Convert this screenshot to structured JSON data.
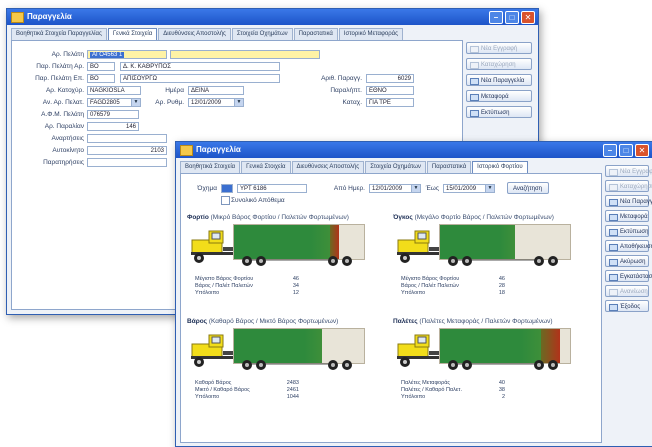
{
  "colors": {
    "accent": "#2f63cf",
    "fill_green": "#2e8a3c",
    "fill_red": "#b2321a",
    "trailer": "#e8e4d8",
    "cab_yellow": "#f2dd1a"
  },
  "back_window": {
    "title": "Παραγγελία",
    "tabs": [
      "Βοηθητικά Στοιχεία Παραγγελίας",
      "Γενικά Στοιχεία",
      "Διευθύνσεις Αποστολής",
      "Στοιχεία Οχημάτων",
      "Παραστατικά",
      "Ιστορικό Μεταφοράς"
    ],
    "active_tab": 1,
    "fields": [
      {
        "label": "Αρ. Πελάτη",
        "value": "ΑΓΟ4563 1"
      },
      {
        "label": "Παρ. Πελάτη Αρ.",
        "value": "BO"
      },
      {
        "label": "Παρ. Πελάτη Επ.",
        "value": "BO"
      },
      {
        "label": "Αρ. Κατοχύρ.",
        "value": "NAGKIOSLA"
      },
      {
        "label": "Αν. Αρ. Πελατ.",
        "value": "FAGD2805"
      },
      {
        "label": "Α.Φ.Μ. Πελάτη",
        "value": "076579"
      },
      {
        "label": "Αρ. Παραλίαν",
        "value": "146"
      },
      {
        "label": "Αναρτήσεις",
        "value": ""
      },
      {
        "label": "Αυτοκίνητο",
        "value": "2103"
      },
      {
        "label": "Παρατηρήσεις",
        "value": ""
      }
    ],
    "field_extra": {
      "name1": "Δ. Κ. ΚΑΘΡΥΠΟΣ",
      "name2": "ΑΠΙΣΟΥΡΓΩ"
    },
    "mid_fields": [
      {
        "label": "Ημέρα",
        "value": "ΔΕΙΝΑ"
      },
      {
        "label": "Αρ. Ρυθμ.",
        "value": "12/01/2009"
      }
    ],
    "right_fields": [
      {
        "label": "Αριθ. Παραγγ.",
        "value": "6029"
      },
      {
        "label": "Παραλήπτ.",
        "value": "ΕΘΝΟ"
      },
      {
        "label": "Καταχ.",
        "value": "ΓΙΑ ΤΡΕ"
      }
    ],
    "side_buttons": [
      {
        "label": "Νέα Εγγραφή",
        "enabled": false
      },
      {
        "label": "Καταχώρηση",
        "enabled": false
      },
      {
        "label": "Νέα Παραγγελία",
        "enabled": true
      },
      {
        "label": "Μεταφορά",
        "enabled": true
      },
      {
        "label": "Εκτύπωση",
        "enabled": true
      }
    ]
  },
  "front_window": {
    "title": "Παραγγελία",
    "tabs": [
      "Βοηθητικά Στοιχεία",
      "Γενικά Στοιχεία",
      "Διευθύνσεις Αποστολής",
      "Στοιχεία Οχημάτων",
      "Παραστατικά",
      "Ιστορικό Φορτίου"
    ],
    "active_tab": 5,
    "filter": {
      "type_label": "Όχημα",
      "vehicle_value": "ΥΡΤ 6186",
      "checkbox_label": "Συνολικό Απόθεμα",
      "from_label": "Από Ημερ.",
      "from_value": "12/01/2009",
      "to_label": "Έως",
      "to_value": "15/01/2009",
      "button": "Αναζήτηση"
    },
    "panels": [
      {
        "title": "Φορτίο",
        "subtitle": "(Μικρό Βάρος Φορτίου / Παλετών Φορτωμένων)",
        "green_pct": 0.74,
        "red_pct": 0.07,
        "stats": [
          {
            "label": "Μέγιστο Βάρος Φορτίου",
            "value": "46"
          },
          {
            "label": "Βάρος / Παλέτ Παλετών",
            "value": "34"
          },
          {
            "label": "Υπόλοιπο",
            "value": "12"
          }
        ]
      },
      {
        "title": "Όγκος",
        "subtitle": "(Μεγάλο Φορτίο Βάρος / Παλετών Φορτωμένων)",
        "green_pct": 0.58,
        "red_pct": 0.0,
        "stats": [
          {
            "label": "Μέγιστο Βάρος Φορτίου",
            "value": "46"
          },
          {
            "label": "Βάρος / Παλέτ Παλετών",
            "value": "28"
          },
          {
            "label": "Υπόλοιπο",
            "value": "18"
          }
        ]
      },
      {
        "title": "Βάρος",
        "subtitle": "(Καθαρό Βάρος / Μικτό Βάρος Φορτωμένων)",
        "green_pct": 0.68,
        "red_pct": 0.0,
        "stats": [
          {
            "label": "Καθαρό Βάρος",
            "value": "2483"
          },
          {
            "label": "Μικτό / Καθαρό Βάρος",
            "value": "2461"
          },
          {
            "label": "Υπόλοιπο",
            "value": "1044"
          }
        ]
      },
      {
        "title": "Παλέτες",
        "subtitle": "(Παλέτες Μεταφοράς / Παλετών Φορτωμένων)",
        "green_pct": 0.78,
        "red_pct": 0.14,
        "stats": [
          {
            "label": "Παλέτες Μεταφοράς",
            "value": "40"
          },
          {
            "label": "Παλέτες / Καθαρό Παλετ.",
            "value": "38"
          },
          {
            "label": "Υπόλοιπο",
            "value": "2"
          }
        ]
      }
    ],
    "side_buttons": [
      {
        "label": "Νέα Εγγραφή",
        "enabled": false
      },
      {
        "label": "Καταχώρηση",
        "enabled": false
      },
      {
        "label": "Νέα Παραγγελία",
        "enabled": true
      },
      {
        "label": "Μεταφορά",
        "enabled": true
      },
      {
        "label": "Εκτύπωση",
        "enabled": true
      },
      {
        "label": "Αποθήκευση",
        "enabled": true
      },
      {
        "label": "Ακύρωση",
        "enabled": true
      },
      {
        "label": "Εγκατάσταση",
        "enabled": true
      },
      {
        "label": "Ανανέωση",
        "enabled": false
      },
      {
        "label": "Έξοδος",
        "enabled": true
      }
    ]
  }
}
